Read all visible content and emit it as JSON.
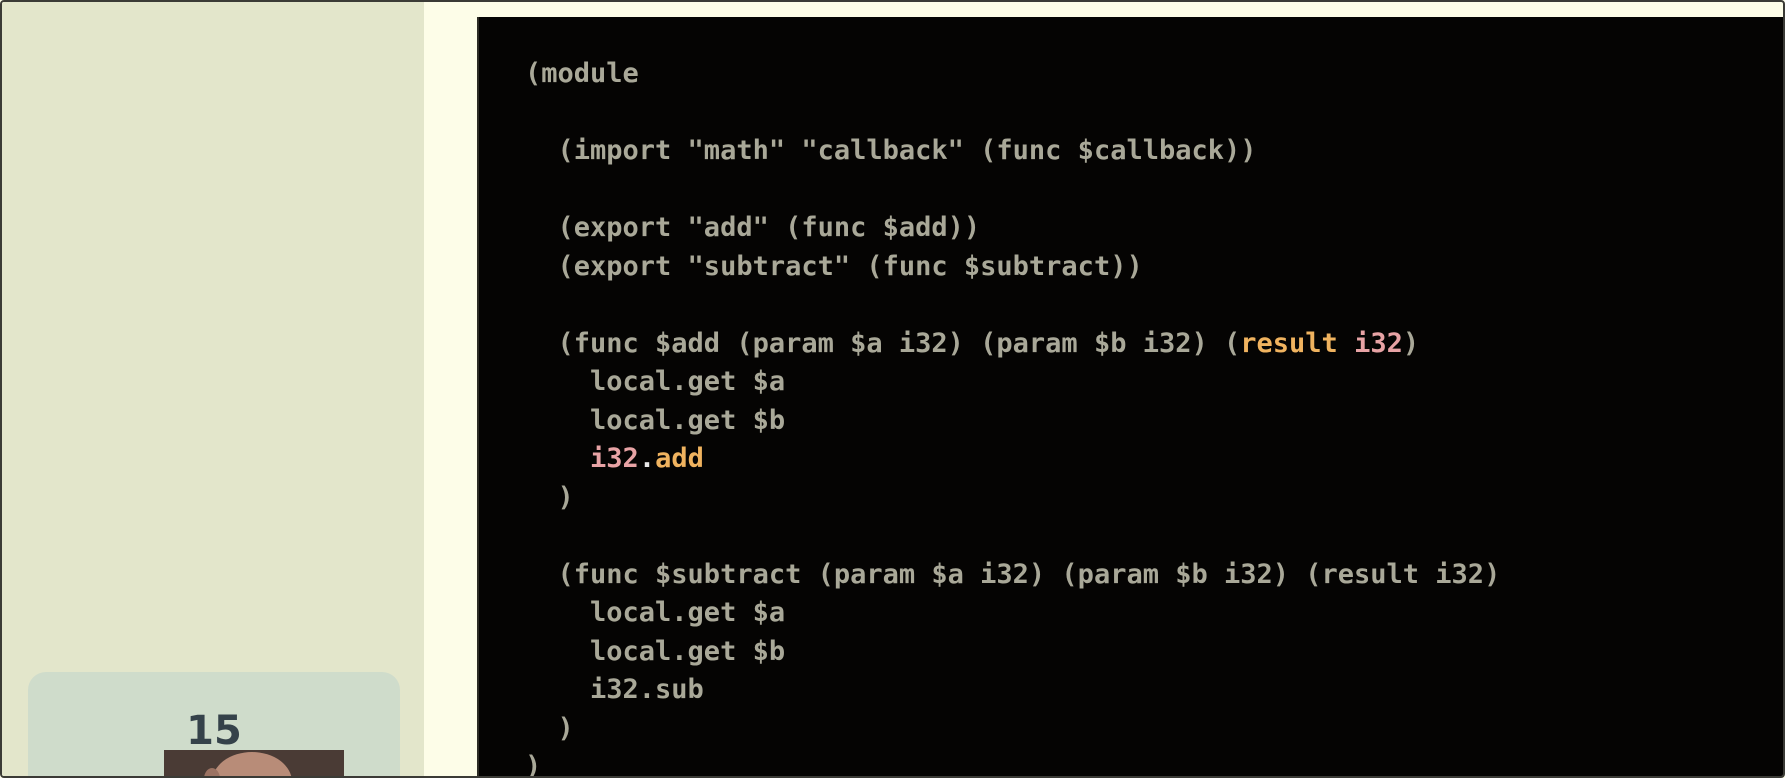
{
  "slide": {
    "number": "15"
  },
  "code": {
    "lines": [
      "(module",
      "",
      "  (import \"math\" \"callback\" (func $callback))",
      "",
      "  (export \"add\" (func $add))",
      "  (export \"subtract\" (func $subtract))",
      "",
      "  (func $add (param $a i32) (param $b i32) (result i32)",
      "    local.get $a",
      "    local.get $b",
      "    i32.add",
      "  )",
      "",
      "  (func $subtract (param $a i32) (param $b i32) (result i32)",
      "    local.get $a",
      "    local.get $b",
      "    i32.sub",
      "  )",
      ")"
    ],
    "highlight": {
      "line8_prefix": "  (func $add (param $a i32) (param $b i32) (",
      "line8_result": "result",
      "line8_space": " ",
      "line8_i32": "i32",
      "line8_suffix": ")",
      "line11_prefix": "    ",
      "line11_i32": "i32",
      "line11_dot": ".",
      "line11_add": "add"
    }
  },
  "colors": {
    "background": "#fdfde8",
    "sidebar": "#e3e6cb",
    "slide_card": "#cfdccb",
    "code_background": "#050403",
    "code_text": "#a9a898",
    "keyword_orange": "#f0b35f",
    "type_pink": "#e8a3a5"
  },
  "icons": {
    "webcam": "presenter-webcam"
  }
}
